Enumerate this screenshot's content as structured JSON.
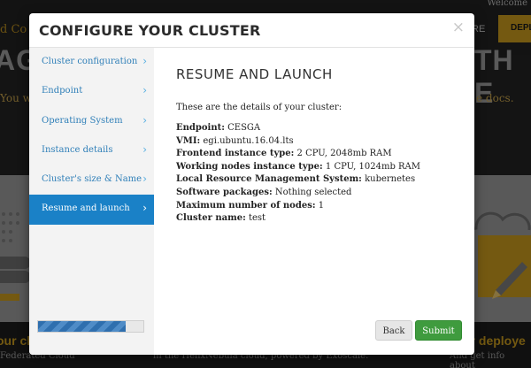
{
  "background": {
    "brand": "d Co",
    "welcome": "Welcome",
    "nav_link": "RE",
    "deploy_button": "DEPL",
    "hero_left": "AG",
    "hero_right": "TH E",
    "subtitle_left": "You w",
    "subtitle_right": "e docs.",
    "footer_left_title": "our cl",
    "footer_right_title": "ur deploye",
    "footer_left_text": "Federated Cloud",
    "footer_mid_text": "in the HelixNebula cloud, powered by Exoscale.",
    "footer_right_text": "And get info about"
  },
  "modal": {
    "title": "CONFIGURE YOUR CLUSTER",
    "close_icon": "close-icon",
    "sidebar": {
      "items": [
        {
          "label": "Cluster configuration",
          "active": false
        },
        {
          "label": "Endpoint",
          "active": false
        },
        {
          "label": "Operating System",
          "active": false
        },
        {
          "label": "Instance details",
          "active": false
        },
        {
          "label": "Cluster's size & Name",
          "active": false
        },
        {
          "label": "Resume and launch",
          "active": true
        }
      ],
      "progress": 0.83
    },
    "content": {
      "title": "RESUME AND LAUNCH",
      "intro": "These are the details of your cluster:",
      "details": [
        {
          "key": "Endpoint:",
          "value": "CESGA"
        },
        {
          "key": "VMI:",
          "value": "egi.ubuntu.16.04.lts"
        },
        {
          "key": "Frontend instance type:",
          "value": "2 CPU, 2048mb RAM"
        },
        {
          "key": "Working nodes instance type:",
          "value": "1 CPU, 1024mb RAM"
        },
        {
          "key": "Local Resource Management System:",
          "value": "kubernetes"
        },
        {
          "key": "Software packages:",
          "value": "Nothing selected"
        },
        {
          "key": "Maximum number of nodes:",
          "value": "1"
        },
        {
          "key": "Cluster name:",
          "value": "test"
        }
      ]
    },
    "buttons": {
      "back": "Back",
      "submit": "Submit"
    }
  },
  "colors": {
    "accent": "#1a81c7",
    "submit": "#3f9b3e",
    "brand_gold": "#c99a1e"
  }
}
